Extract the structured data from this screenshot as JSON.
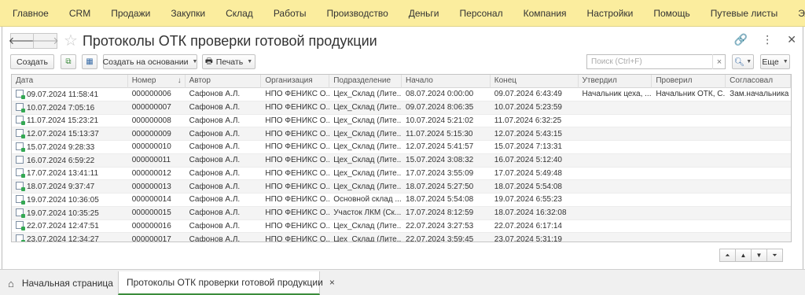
{
  "top_menu": [
    "Главное",
    "CRM",
    "Продажи",
    "Закупки",
    "Склад",
    "Работы",
    "Производство",
    "Деньги",
    "Персонал",
    "Компания",
    "Настройки",
    "Помощь",
    "Путевые листы",
    "Эл. торго"
  ],
  "window": {
    "title": "Протоколы ОТК проверки готовой продукции",
    "back_icon": "arrow-left-icon",
    "forward_icon": "arrow-right-icon",
    "favorite_icon": "star-icon",
    "link_icon": "link-icon",
    "more_icon": "more-vertical-icon",
    "close_icon": "close-icon"
  },
  "toolbar": {
    "create_label": "Создать",
    "create_based_label": "Создать на основании",
    "print_label": "Печать",
    "search_placeholder": "Поиск (Ctrl+F)",
    "search_clear": "×",
    "more_label": "Еще"
  },
  "table": {
    "columns": [
      "Дата",
      "Номер",
      "Автор",
      "Организация",
      "Подразделение",
      "Начало",
      "Конец",
      "Утвердил",
      "Проверил",
      "Согласовал"
    ],
    "rows": [
      [
        "09.07.2024 11:58:41",
        "000000006",
        "Сафонов А.Л.",
        "НПО ФЕНИКС О...",
        "Цех_Склад (Лите...",
        "08.07.2024 0:00:00",
        "09.07.2024 6:43:49",
        "Начальник цеха, ...",
        "Начальник ОТК, С...",
        "Зам.начальника ..."
      ],
      [
        "10.07.2024 7:05:16",
        "000000007",
        "Сафонов А.Л.",
        "НПО ФЕНИКС О...",
        "Цех_Склад (Лите...",
        "09.07.2024 8:06:35",
        "10.07.2024 5:23:59",
        "",
        "",
        ""
      ],
      [
        "11.07.2024 15:23:21",
        "000000008",
        "Сафонов А.Л.",
        "НПО ФЕНИКС О...",
        "Цех_Склад (Лите...",
        "10.07.2024 5:21:02",
        "11.07.2024 6:32:25",
        "",
        "",
        ""
      ],
      [
        "12.07.2024 15:13:37",
        "000000009",
        "Сафонов А.Л.",
        "НПО ФЕНИКС О...",
        "Цех_Склад (Лите...",
        "11.07.2024 5:15:30",
        "12.07.2024 5:43:15",
        "",
        "",
        ""
      ],
      [
        "15.07.2024 9:28:33",
        "000000010",
        "Сафонов А.Л.",
        "НПО ФЕНИКС О...",
        "Цех_Склад (Лите...",
        "12.07.2024 5:41:57",
        "15.07.2024 7:13:31",
        "",
        "",
        ""
      ],
      [
        "16.07.2024 6:59:22",
        "000000011",
        "Сафонов А.Л.",
        "НПО ФЕНИКС О...",
        "Цех_Склад (Лите...",
        "15.07.2024 3:08:32",
        "16.07.2024 5:12:40",
        "",
        "",
        ""
      ],
      [
        "17.07.2024 13:41:11",
        "000000012",
        "Сафонов А.Л.",
        "НПО ФЕНИКС О...",
        "Цех_Склад (Лите...",
        "17.07.2024 3:55:09",
        "17.07.2024 5:49:48",
        "",
        "",
        ""
      ],
      [
        "18.07.2024 9:37:47",
        "000000013",
        "Сафонов А.Л.",
        "НПО ФЕНИКС О...",
        "Цех_Склад (Лите...",
        "18.07.2024 5:27:50",
        "18.07.2024 5:54:08",
        "",
        "",
        ""
      ],
      [
        "19.07.2024 10:36:05",
        "000000014",
        "Сафонов А.Л.",
        "НПО ФЕНИКС О...",
        "Основной склад ...",
        "18.07.2024 5:54:08",
        "19.07.2024 6:55:23",
        "",
        "",
        ""
      ],
      [
        "19.07.2024 10:35:25",
        "000000015",
        "Сафонов А.Л.",
        "НПО ФЕНИКС О...",
        "Участок ЛКМ (Ск...",
        "17.07.2024 8:12:59",
        "18.07.2024 16:32:08",
        "",
        "",
        ""
      ],
      [
        "22.07.2024 12:47:51",
        "000000016",
        "Сафонов А.Л.",
        "НПО ФЕНИКС О...",
        "Цех_Склад (Лите...",
        "22.07.2024 3:27:53",
        "22.07.2024 6:17:14",
        "",
        "",
        ""
      ],
      [
        "23.07.2024 12:34:27",
        "000000017",
        "Сафонов А.Л.",
        "НПО ФЕНИКС О...",
        "Цех_Склад (Лите...",
        "22.07.2024 3:59:45",
        "23.07.2024 5:31:19",
        "",
        "",
        ""
      ]
    ],
    "plain_icon_row_index": 5
  },
  "tabs": {
    "home_label": "Начальная страница",
    "active_label": "Протоколы ОТК проверки готовой продукции",
    "close_glyph": "×"
  },
  "colors": {
    "menu_background": "#fbed9e",
    "active_tab_underline": "#3c8c3c"
  }
}
